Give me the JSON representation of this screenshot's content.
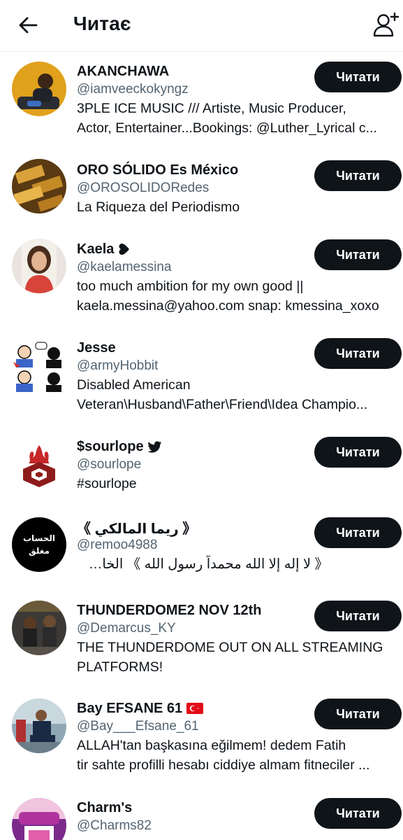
{
  "header": {
    "title": "Читає",
    "back_icon": "arrow-left-icon",
    "add_icon": "add-user-icon"
  },
  "follow_label": "Читати",
  "users": [
    {
      "name": "AKANCHAWA",
      "handle": "@iamveeckokyngz",
      "bio_lines": [
        "3PLE ICE MUSIC /// Artiste, Music Producer,",
        "Actor, Entertainer...Bookings: @Luther_Lyrical c..."
      ]
    },
    {
      "name": "ORO SÓLIDO Es México",
      "handle": "@OROSOLIDORedes",
      "bio_lines": [
        "La Riqueza del Periodismo"
      ]
    },
    {
      "name": "Kaela",
      "name_badge_icon": "heart-icon",
      "handle": "@kaelamessina",
      "bio_lines": [
        "too much ambition for my own good ||",
        "kaela.messina@yahoo.com snap: kmessina_xoxo"
      ]
    },
    {
      "name": "Jesse",
      "handle": "@armyHobbit",
      "bio_lines": [
        "Disabled American",
        "Veteran\\Husband\\Father\\Friend\\Idea Champio..."
      ]
    },
    {
      "name": "$sourlope",
      "name_badge_icon": "bird-icon",
      "handle": "@sourlope",
      "bio_lines": [
        "#sourlope"
      ]
    },
    {
      "name": "《 ريما المالكي 》",
      "avatar_text": [
        "الحساب",
        "مغلق"
      ],
      "handle": "@remoo4988",
      "bio_lines": [
        "《 لا إله إلا الله محمداً رسول الله 》 الخاص ممنوع"
      ]
    },
    {
      "name": "THUNDERDOME2 NOV 12th",
      "handle": "@Demarcus_KY",
      "bio_lines": [
        "THE THUNDERDOME OUT ON ALL STREAMING",
        "PLATFORMS!"
      ]
    },
    {
      "name": "Bay EFSANE 61",
      "name_badge_icon": "turkey-flag-icon",
      "handle": "@Bay___Efsane_61",
      "bio_lines": [
        "ALLAH'tan başkasına eğilmem! dedem Fatih",
        "tir sahte profilli hesabı ciddiye almam fitneciler ..."
      ]
    },
    {
      "name": "Charm's",
      "handle": "@Charms82",
      "bio_lines": []
    }
  ]
}
